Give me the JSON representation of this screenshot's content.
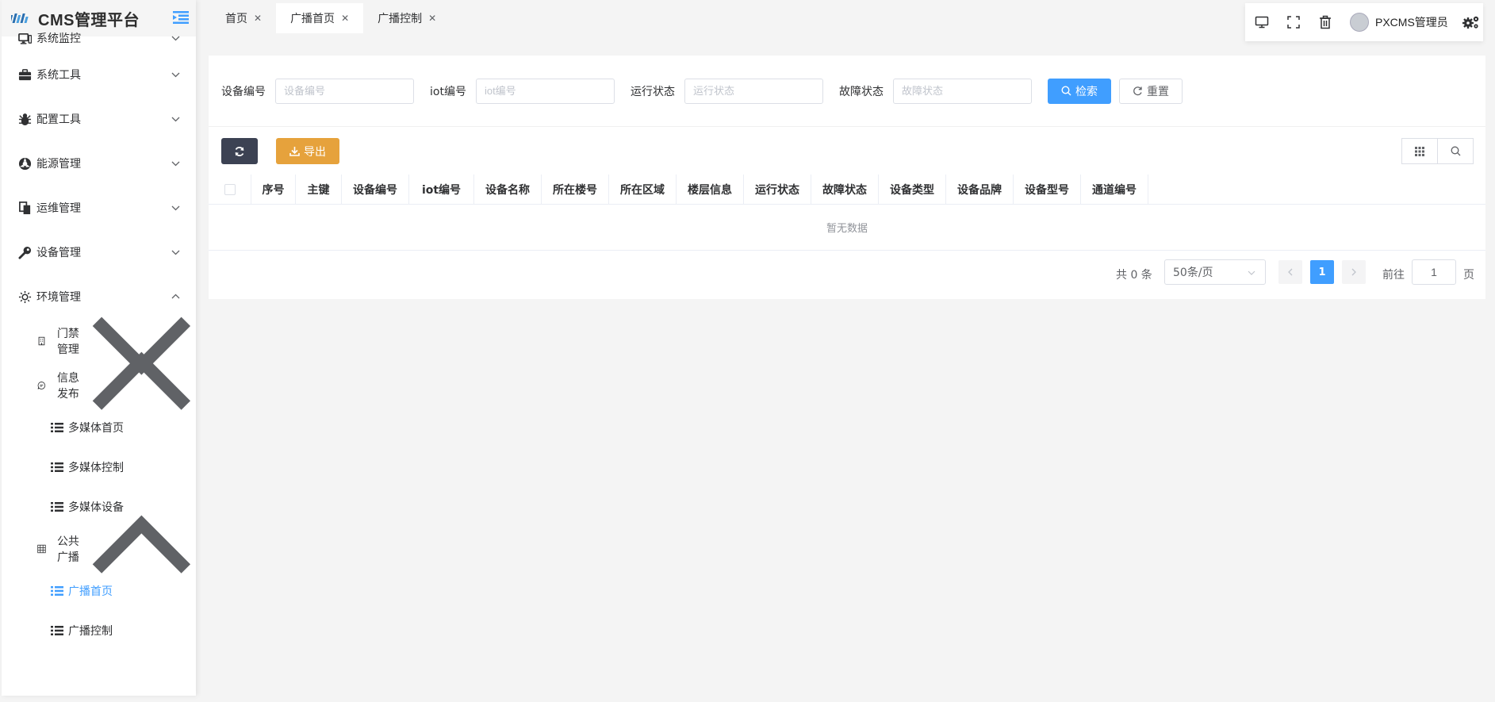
{
  "app": {
    "title": "CMS管理平台"
  },
  "sidebar": {
    "items": [
      {
        "label": "系统监控",
        "icon": "monitor-icon",
        "expanded": false
      },
      {
        "label": "系统工具",
        "icon": "toolbox-icon",
        "expanded": false
      },
      {
        "label": "配置工具",
        "icon": "bug-icon",
        "expanded": false
      },
      {
        "label": "能源管理",
        "icon": "energy-icon",
        "expanded": false
      },
      {
        "label": "运维管理",
        "icon": "documents-icon",
        "expanded": false
      },
      {
        "label": "设备管理",
        "icon": "wrench-icon",
        "expanded": false
      },
      {
        "label": "环境管理",
        "icon": "sun-icon",
        "expanded": true
      }
    ],
    "env": {
      "access": {
        "label": "门禁管理",
        "icon": "building-icon"
      },
      "info": {
        "label": "信息发布",
        "icon": "chat-icon"
      },
      "info_children": [
        "多媒体首页",
        "多媒体控制",
        "多媒体设备"
      ],
      "broadcast": {
        "label": "公共广播",
        "icon": "grid-icon"
      },
      "broadcast_children": [
        "广播首页",
        "广播控制"
      ],
      "active_leaf": "广播首页"
    }
  },
  "tabs": [
    {
      "label": "首页",
      "active": false
    },
    {
      "label": "广播首页",
      "active": true
    },
    {
      "label": "广播控制",
      "active": false
    }
  ],
  "topbar": {
    "icons": [
      "monitor-icon",
      "fullscreen-icon",
      "trash-icon"
    ],
    "username": "PXCMS管理员",
    "settings_icon": "gears-icon"
  },
  "search": {
    "fields": [
      {
        "label": "设备编号",
        "placeholder": "设备编号"
      },
      {
        "label": "iot编号",
        "placeholder": "iot编号"
      },
      {
        "label": "运行状态",
        "placeholder": "运行状态"
      },
      {
        "label": "故障状态",
        "placeholder": "故障状态"
      }
    ],
    "search_label": "检索",
    "reset_label": "重置"
  },
  "toolbar": {
    "refresh_icon": "refresh-icon",
    "export_label": "导出",
    "grid_icon": "columns-icon",
    "search_icon": "search-icon"
  },
  "table": {
    "columns": [
      "序号",
      "主键",
      "设备编号",
      "iot编号",
      "设备名称",
      "所在楼号",
      "所在区域",
      "楼层信息",
      "运行状态",
      "故障状态",
      "设备类型",
      "设备品牌",
      "设备型号",
      "通道编号"
    ],
    "empty_text": "暂无数据",
    "rows": []
  },
  "pagination": {
    "total_text": "共 0 条",
    "page_size": "50条/页",
    "current_page": "1",
    "goto_label": "前往",
    "goto_value": "1",
    "page_unit": "页"
  },
  "colors": {
    "primary": "#409eff",
    "warning": "#e6a23c",
    "dark": "#3c4253"
  }
}
